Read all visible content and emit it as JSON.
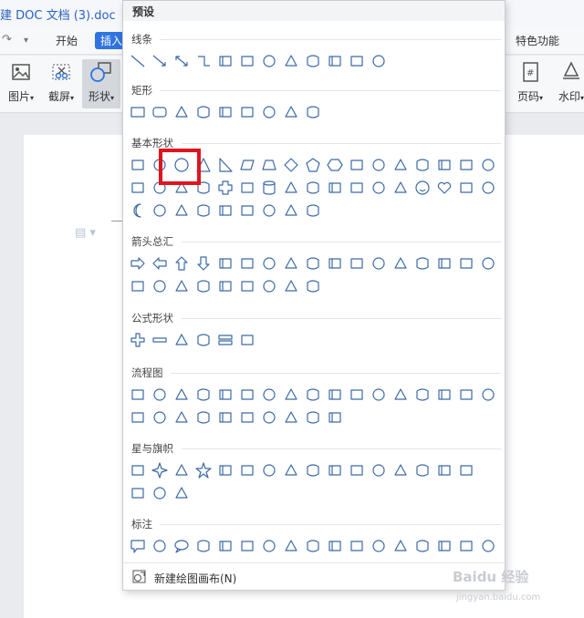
{
  "window": {
    "title": "建 DOC 文档 (3).doc"
  },
  "tabs": {
    "home": "开始",
    "insert": "插入",
    "special": "特色功能"
  },
  "ribbon": {
    "picture": "图片",
    "screenshot": "截屏",
    "shapes": "形状",
    "page_number": "页码",
    "watermark": "水印"
  },
  "dropdown": {
    "header": "预设",
    "sections": [
      {
        "title": "线条",
        "rows": [
          [
            "line",
            "line-arrow",
            "line-double-arrow",
            "elbow",
            "elbow-arrow",
            "elbow-double-arrow",
            "curve",
            "curve-arrow",
            "curve-double-arrow",
            "s-curve",
            "freeform",
            "scribble"
          ]
        ]
      },
      {
        "title": "矩形",
        "rows": [
          [
            "rect",
            "round-rect",
            "snip-one",
            "snip-same",
            "snip-diag",
            "snip-round",
            "round-one",
            "round-same",
            "round-diag"
          ]
        ]
      },
      {
        "title": "基本形状",
        "rows": [
          [
            "textbox",
            "textbox-v",
            "oval",
            "triangle",
            "right-triangle",
            "parallelogram",
            "trapezoid",
            "diamond",
            "pentagon",
            "hexagon",
            "heptagon-7",
            "octagon-8",
            "decagon-10",
            "dodecagon-12",
            "pie",
            "chord",
            "teardrop"
          ],
          [
            "frame",
            "half-frame",
            "l-shape",
            "diagonal",
            "plus",
            "octagon",
            "can",
            "cube",
            "bevel",
            "donut",
            "no-symbol",
            "block-arc",
            "folded-corner",
            "smiley",
            "heart",
            "lightning",
            "sun"
          ],
          [
            "moon",
            "cloud",
            "arc",
            "bracket-pair",
            "brace-pair",
            "left-bracket",
            "right-bracket",
            "left-brace",
            "right-brace"
          ]
        ]
      },
      {
        "title": "箭头总汇",
        "rows": [
          [
            "arrow-right",
            "arrow-left",
            "arrow-up",
            "arrow-down",
            "arrow-lr",
            "arrow-ud",
            "arrow-quad",
            "arrow-lru",
            "arrow-bent",
            "arrow-uturn",
            "arrow-left-up",
            "arrow-bent-up",
            "arrow-curved-right",
            "arrow-curved-left",
            "arrow-curved-up",
            "arrow-curved-down",
            "arrow-striped"
          ],
          [
            "arrow-notched",
            "pentagon-arrow",
            "chevron",
            "callout-right",
            "callout-up",
            "callout-down",
            "callout-quad",
            "callout-cross",
            "arrow-circular"
          ]
        ]
      },
      {
        "title": "公式形状",
        "rows": [
          [
            "math-plus",
            "math-minus",
            "math-multiply",
            "math-divide",
            "math-equal",
            "math-not-equal"
          ]
        ]
      },
      {
        "title": "流程图",
        "rows": [
          [
            "fc-process",
            "fc-alt-process",
            "fc-decision",
            "fc-data",
            "fc-predefined",
            "fc-internal",
            "fc-document",
            "fc-multidoc",
            "fc-terminator",
            "fc-preparation",
            "fc-manual-input",
            "fc-manual-op",
            "fc-connector",
            "fc-offpage",
            "fc-card",
            "fc-tape",
            "fc-sum"
          ],
          [
            "fc-or",
            "fc-collate",
            "fc-sort",
            "fc-extract",
            "fc-merge",
            "fc-delay",
            "fc-stored",
            "fc-disk",
            "fc-drum",
            "fc-display"
          ]
        ]
      },
      {
        "title": "星与旗帜",
        "rows": [
          [
            "explosion",
            "star4",
            "star4b",
            "star5",
            "star6",
            "star8",
            "star10",
            "star12",
            "star16",
            "star24",
            "star32",
            "ribbon-down",
            "ribbon-up",
            "ribbon-curved-down",
            "ribbon-curved-up",
            "scroll-v"
          ],
          [
            "scroll-h",
            "wave",
            "double-wave"
          ]
        ]
      },
      {
        "title": "标注",
        "rows": [
          [
            "callout-rect",
            "callout-roundrect",
            "callout-oval",
            "callout-cloud",
            "line-callout-1",
            "line-callout-2",
            "line-callout-3",
            "line-callout-4",
            "accent-1",
            "accent-2",
            "accent-3",
            "accent-4",
            "border-1",
            "border-2",
            "border-3",
            "accent-border-1",
            "accent-border-2"
          ]
        ]
      }
    ],
    "footer": "新建绘图画布(N)"
  },
  "watermark": {
    "text": "Baidu 经验",
    "sub": "jingyan.baidu.com"
  },
  "colors": {
    "accent": "#2f74e0",
    "highlight": "#e0141e",
    "shape_stroke": "#3c6aa5"
  }
}
